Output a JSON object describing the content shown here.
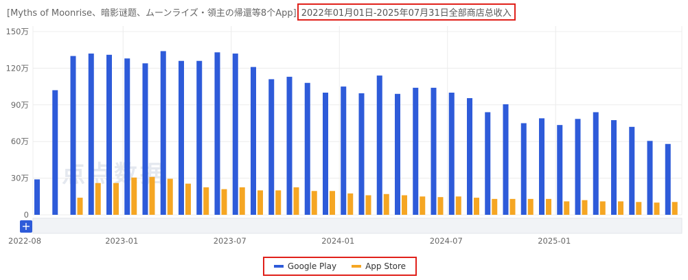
{
  "title": {
    "main": "[Myths of Moonrise、暗影谜题、ムーンライズ・領主の帰還等8个App]",
    "range": "2022年01月01日-2025年07月31日全部商店总收入"
  },
  "watermark": "点点数据",
  "zoom_label": "+",
  "colors": {
    "google_play": "#2e5bd9",
    "app_store": "#f5a623",
    "grid": "#ececec",
    "axis_text": "#666666"
  },
  "legend": [
    {
      "name": "Google Play",
      "color": "#2e5bd9"
    },
    {
      "name": "App Store",
      "color": "#f5a623"
    }
  ],
  "chart_data": {
    "type": "bar",
    "ylim": [
      0,
      1500000
    ],
    "yticks": [
      {
        "value": 0,
        "label": "0"
      },
      {
        "value": 300000,
        "label": "30万"
      },
      {
        "value": 600000,
        "label": "60万"
      },
      {
        "value": 900000,
        "label": "90万"
      },
      {
        "value": 1200000,
        "label": "120万"
      },
      {
        "value": 1500000,
        "label": "150万"
      }
    ],
    "xtick_labels": [
      {
        "label": "2022-08",
        "index": 0
      },
      {
        "label": "2023-01",
        "index": 5
      },
      {
        "label": "2023-07",
        "index": 11
      },
      {
        "label": "2024-01",
        "index": 17
      },
      {
        "label": "2024-07",
        "index": 23
      },
      {
        "label": "2025-01",
        "index": 29
      }
    ],
    "categories": [
      "2022-08",
      "2022-09",
      "2022-10",
      "2022-11",
      "2022-12",
      "2023-01",
      "2023-02",
      "2023-03",
      "2023-04",
      "2023-05",
      "2023-06",
      "2023-07",
      "2023-08",
      "2023-09",
      "2023-10",
      "2023-11",
      "2023-12",
      "2024-01",
      "2024-02",
      "2024-03",
      "2024-04",
      "2024-05",
      "2024-06",
      "2024-07",
      "2024-08",
      "2024-09",
      "2024-10",
      "2024-11",
      "2024-12",
      "2025-01",
      "2025-02",
      "2025-03",
      "2025-04",
      "2025-05",
      "2025-06",
      "2025-07"
    ],
    "series": [
      {
        "name": "Google Play",
        "values": [
          290000,
          1020000,
          1300000,
          1320000,
          1310000,
          1280000,
          1240000,
          1340000,
          1260000,
          1260000,
          1330000,
          1320000,
          1210000,
          1110000,
          1130000,
          1080000,
          1000000,
          1050000,
          995000,
          1140000,
          990000,
          1040000,
          1040000,
          1000000,
          955000,
          840000,
          905000,
          750000,
          790000,
          735000,
          785000,
          840000,
          775000,
          720000,
          605000,
          580000
        ]
      },
      {
        "name": "App Store",
        "values": [
          0,
          0,
          140000,
          260000,
          260000,
          305000,
          310000,
          295000,
          255000,
          225000,
          210000,
          225000,
          200000,
          200000,
          225000,
          195000,
          195000,
          175000,
          160000,
          170000,
          160000,
          150000,
          145000,
          150000,
          140000,
          130000,
          130000,
          130000,
          130000,
          110000,
          120000,
          110000,
          110000,
          105000,
          100000,
          105000
        ]
      }
    ]
  }
}
